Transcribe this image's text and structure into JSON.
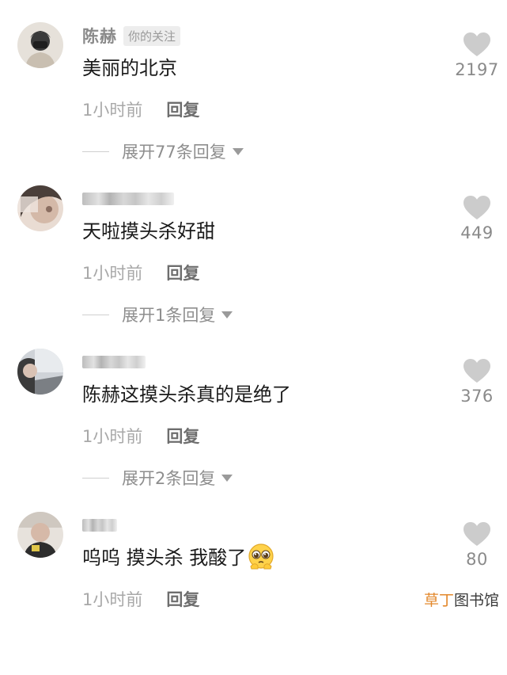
{
  "comments": [
    {
      "username": "陈赫",
      "badge": "你的关注",
      "text": "美丽的北京",
      "time": "1小时前",
      "reply_label": "回复",
      "expand_label": "展开77条回复",
      "likes": "2197"
    },
    {
      "username": "",
      "text": "天啦摸头杀好甜",
      "time": "1小时前",
      "reply_label": "回复",
      "expand_label": "展开1条回复",
      "likes": "449"
    },
    {
      "username": "",
      "text": "陈赫这摸头杀真的是绝了",
      "time": "1小时前",
      "reply_label": "回复",
      "expand_label": "展开2条回复",
      "likes": "376"
    },
    {
      "username": "",
      "text": "呜呜 摸头杀 我酸了",
      "emoji": "pleading-face-emoji",
      "time": "1小时前",
      "reply_label": "回复",
      "likes": "80"
    }
  ],
  "watermark": {
    "part1": "草丁",
    "part2": "图书馆"
  },
  "colors": {
    "like_heart": "#cccccc",
    "username": "#8a8a8a",
    "watermark_accent": "#e3882c"
  }
}
